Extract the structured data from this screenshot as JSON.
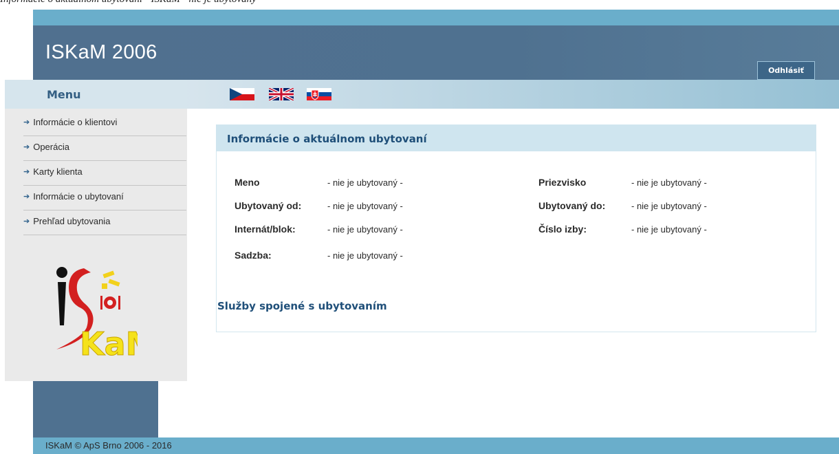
{
  "caption": "Informácie o aktuálnom ubytovaní - ISKaM - nie je ubytovaný",
  "header": {
    "title": "ISKaM 2006",
    "logout_label": "Odhlásiť"
  },
  "languages": [
    "cz-flag-icon",
    "gb-flag-icon",
    "sk-flag-icon"
  ],
  "menu": {
    "title": "Menu",
    "items": [
      {
        "label": "Informácie o klientovi"
      },
      {
        "label": "Operácia"
      },
      {
        "label": "Karty klienta"
      },
      {
        "label": "Informácie o ubytovaní"
      },
      {
        "label": "Prehľad ubytovania"
      }
    ]
  },
  "accommodation": {
    "title": "Informácie o aktuálnom ubytovaní",
    "fields": [
      {
        "label": "Meno",
        "value": "- nie je ubytovaný -"
      },
      {
        "label": "Priezvisko",
        "value": "- nie je ubytovaný -"
      },
      {
        "label": "Ubytovaný od:",
        "value": "- nie je ubytovaný -"
      },
      {
        "label": "Ubytovaný do:",
        "value": "- nie je ubytovaný -"
      },
      {
        "label": "Internát/blok:",
        "value": "- nie je ubytovaný -"
      },
      {
        "label": "Číslo izby:",
        "value": "- nie je ubytovaný -"
      },
      {
        "label": "Sadzba:",
        "value": "- nie je ubytovaný -"
      }
    ],
    "services_link": "Služby spojené s ubytovaním"
  },
  "footer": {
    "text": "ISKaM © ApS Brno 2006 - 2016"
  },
  "colors": {
    "header": "#4f7190",
    "accent": "#6aaecb",
    "title_blue": "#1f4f79"
  }
}
